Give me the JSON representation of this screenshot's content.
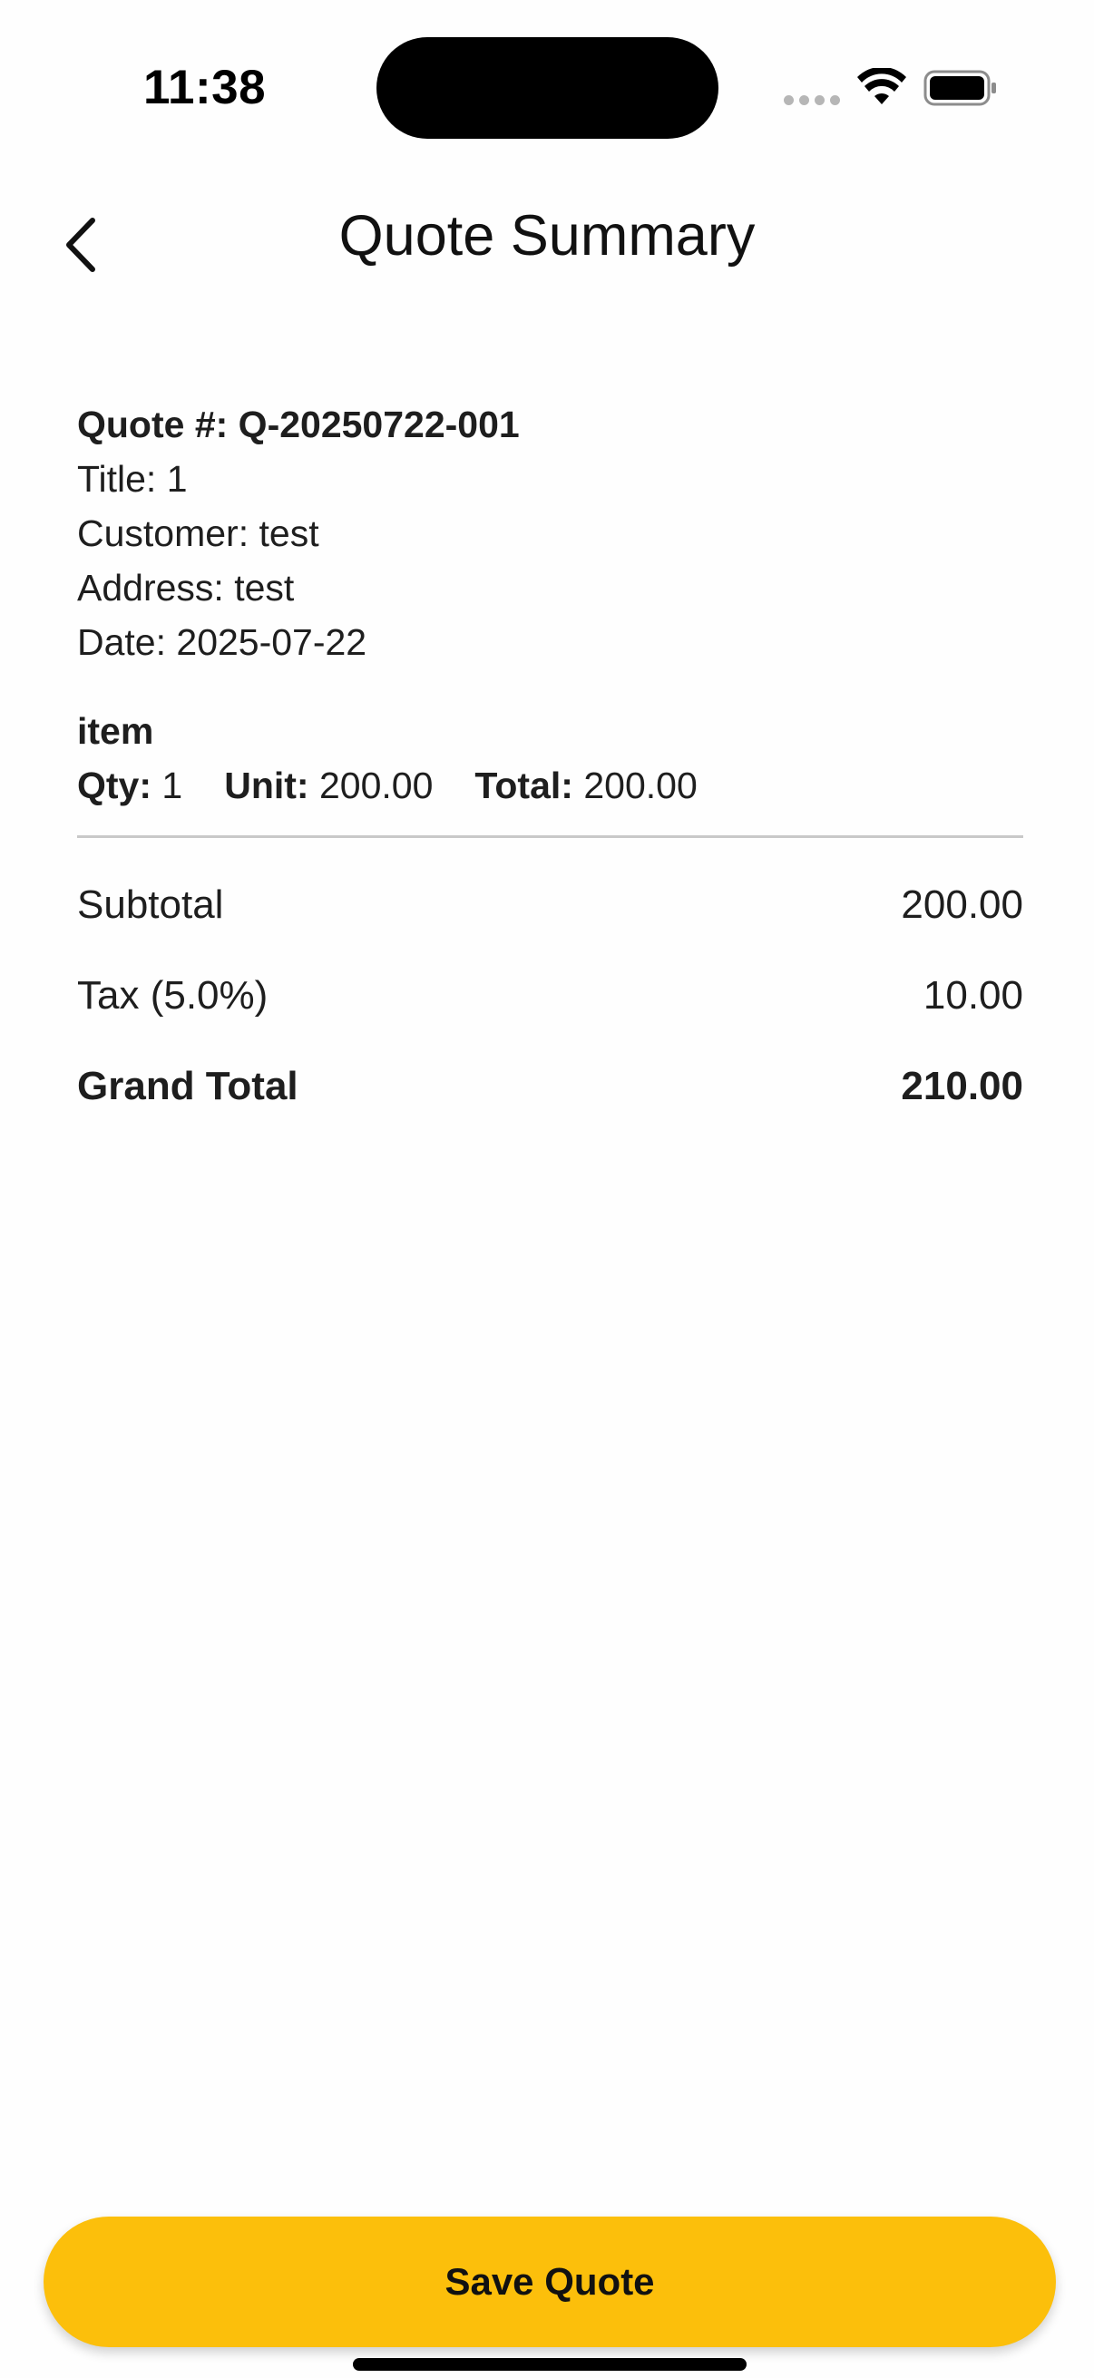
{
  "status_bar": {
    "time": "11:38"
  },
  "nav": {
    "title": "Quote Summary",
    "back_icon": "chevron-left-icon"
  },
  "quote": {
    "number_line": "Quote #: Q-20250722-001",
    "title_line": "Title: 1",
    "customer_line": "Customer: test",
    "address_line": "Address: test",
    "date_line": "Date: 2025-07-22"
  },
  "items": [
    {
      "name": "item",
      "qty_label": "Qty:",
      "qty": "1",
      "unit_label": "Unit:",
      "unit": "200.00",
      "total_label": "Total:",
      "total": "200.00"
    }
  ],
  "totals": {
    "subtotal_label": "Subtotal",
    "subtotal_value": "200.00",
    "tax_label": "Tax (5.0%)",
    "tax_value": "10.00",
    "grand_label": "Grand Total",
    "grand_value": "210.00"
  },
  "actions": {
    "save_label": "Save Quote"
  },
  "colors": {
    "accent": "#fcbf0b",
    "background": "#fefefe",
    "text": "#1e1e1e",
    "divider": "#c9c9c9"
  }
}
